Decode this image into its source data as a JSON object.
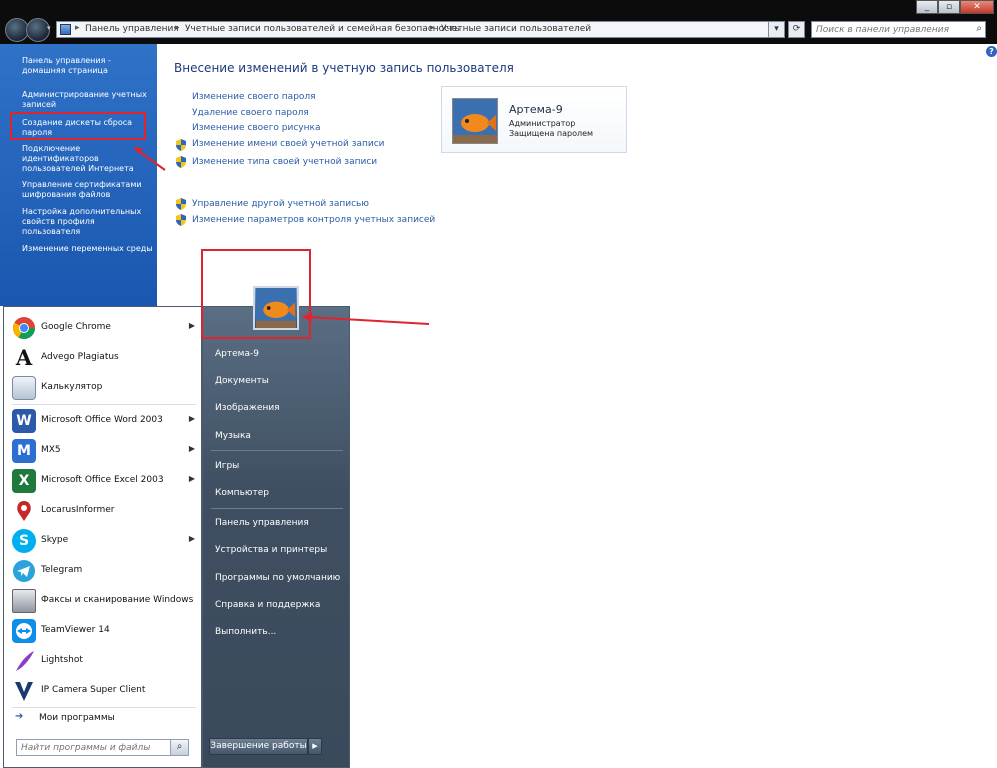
{
  "address_bar": {
    "crumbs": [
      "Панель управления",
      "Учетные записи пользователей и семейная безопасность",
      "Учетные записи пользователей"
    ],
    "search_placeholder": "Поиск в панели управления"
  },
  "left_nav": {
    "items": [
      "Панель управления - домашняя страница",
      "Администрирование учетных записей",
      "Создание дискеты сброса пароля",
      "Подключение идентификаторов пользователей Интернета",
      "Управление сертификатами шифрования файлов",
      "Настройка дополнительных свойств профиля пользователя",
      "Изменение переменных среды"
    ]
  },
  "main": {
    "heading": "Внесение изменений в учетную запись пользователя",
    "links": [
      {
        "label": "Изменение своего пароля",
        "shield": false
      },
      {
        "label": "Удаление своего пароля",
        "shield": false
      },
      {
        "label": "Изменение своего рисунка",
        "shield": false
      },
      {
        "label": "Изменение имени своей учетной записи",
        "shield": true
      },
      {
        "label": "Изменение типа своей учетной записи",
        "shield": true
      }
    ],
    "links2": [
      {
        "label": "Управление другой учетной записью",
        "shield": true
      },
      {
        "label": "Изменение параметров контроля учетных записей",
        "shield": true
      }
    ],
    "user": {
      "name": "Артема-9",
      "role": "Администратор",
      "status": "Защищена паролем"
    }
  },
  "start_menu": {
    "programs": [
      {
        "label": "Google Chrome",
        "icon": "chrome-icon",
        "submenu": true
      },
      {
        "label": "Advego Plagiatus",
        "icon": "advego-icon",
        "submenu": false
      },
      {
        "label": "Калькулятор",
        "icon": "calculator-icon",
        "submenu": false
      },
      {
        "label": "Microsoft Office Word 2003",
        "icon": "word-icon",
        "submenu": true
      },
      {
        "label": "MX5",
        "icon": "maxthon-icon",
        "submenu": true
      },
      {
        "label": "Microsoft Office Excel 2003",
        "icon": "excel-icon",
        "submenu": true
      },
      {
        "label": "LocarusInformer",
        "icon": "locarus-icon",
        "submenu": false
      },
      {
        "label": "Skype",
        "icon": "skype-icon",
        "submenu": true
      },
      {
        "label": "Telegram",
        "icon": "telegram-icon",
        "submenu": false
      },
      {
        "label": "Факсы и сканирование Windows",
        "icon": "fax-icon",
        "submenu": false
      },
      {
        "label": "TeamViewer 14",
        "icon": "teamviewer-icon",
        "submenu": false
      },
      {
        "label": "Lightshot",
        "icon": "lightshot-icon",
        "submenu": false
      },
      {
        "label": "IP Camera Super Client",
        "icon": "ipcamera-icon",
        "submenu": false
      }
    ],
    "all_programs": "Мои программы",
    "search_placeholder": "Найти программы и файлы",
    "right_links": [
      "Артема-9",
      "Документы",
      "Изображения",
      "Музыка",
      "Игры",
      "Компьютер",
      "Панель управления",
      "Устройства и принтеры",
      "Программы по умолчанию",
      "Справка и поддержка",
      "Выполнить..."
    ],
    "shutdown_label": "Завершение работы"
  },
  "colors": {
    "nav_blue": "#1a57b0",
    "link_blue": "#2a5ca8",
    "annotation_red": "#e0242e"
  }
}
